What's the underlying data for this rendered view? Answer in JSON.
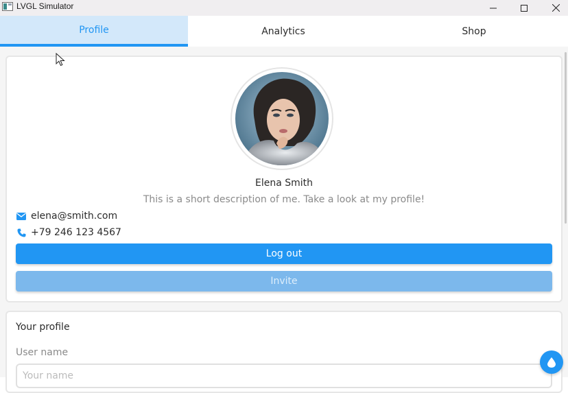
{
  "window": {
    "title": "LVGL Simulator",
    "controls": [
      "minimize-icon",
      "maximize-icon",
      "close-icon"
    ]
  },
  "tabs": [
    {
      "label": "Profile",
      "active": true
    },
    {
      "label": "Analytics",
      "active": false
    },
    {
      "label": "Shop",
      "active": false
    }
  ],
  "profile": {
    "name": "Elena Smith",
    "description": "This is a short description of me. Take a look at my profile!",
    "email": "elena@smith.com",
    "phone": "+79 246 123 4567",
    "logout_label": "Log out",
    "invite_label": "Invite"
  },
  "form": {
    "title": "Your profile",
    "username_label": "User name",
    "username_placeholder": "Your name"
  },
  "colors": {
    "accent": "#2196f3",
    "tab_active_bg": "#d3e8fa",
    "invite_bg": "#7cb8ec"
  },
  "icons": {
    "email": "envelope-icon",
    "phone": "phone-icon",
    "fab": "water-drop-icon"
  }
}
